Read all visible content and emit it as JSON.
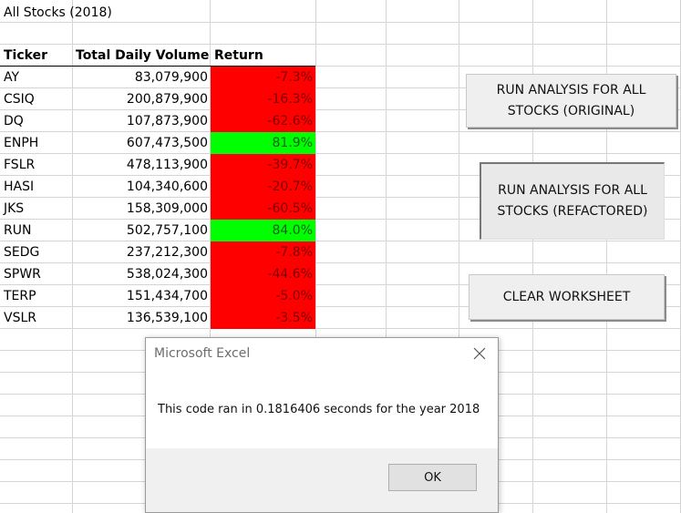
{
  "sheet": {
    "title": "All Stocks (2018)",
    "headers": {
      "ticker": "Ticker",
      "volume": "Total Daily Volume",
      "return": "Return"
    },
    "rows": [
      {
        "ticker": "AY",
        "volume": "83,079,900",
        "return": "-7.3%",
        "status": "negative"
      },
      {
        "ticker": "CSIQ",
        "volume": "200,879,900",
        "return": "-16.3%",
        "status": "negative"
      },
      {
        "ticker": "DQ",
        "volume": "107,873,900",
        "return": "-62.6%",
        "status": "negative"
      },
      {
        "ticker": "ENPH",
        "volume": "607,473,500",
        "return": "81.9%",
        "status": "positive"
      },
      {
        "ticker": "FSLR",
        "volume": "478,113,900",
        "return": "-39.7%",
        "status": "negative"
      },
      {
        "ticker": "HASI",
        "volume": "104,340,600",
        "return": "-20.7%",
        "status": "negative"
      },
      {
        "ticker": "JKS",
        "volume": "158,309,000",
        "return": "-60.5%",
        "status": "negative"
      },
      {
        "ticker": "RUN",
        "volume": "502,757,100",
        "return": "84.0%",
        "status": "positive"
      },
      {
        "ticker": "SEDG",
        "volume": "237,212,300",
        "return": "-7.8%",
        "status": "negative"
      },
      {
        "ticker": "SPWR",
        "volume": "538,024,300",
        "return": "-44.6%",
        "status": "negative"
      },
      {
        "ticker": "TERP",
        "volume": "151,434,700",
        "return": "-5.0%",
        "status": "negative"
      },
      {
        "ticker": "VSLR",
        "volume": "136,539,100",
        "return": "-3.5%",
        "status": "negative"
      }
    ],
    "colors": {
      "negative": "#ff0000",
      "positive": "#00ff00"
    }
  },
  "buttons": {
    "run_original": {
      "line1": "RUN ANALYSIS FOR ALL",
      "line2": "STOCKS (ORIGINAL)"
    },
    "run_refactored": {
      "line1": "RUN ANALYSIS FOR ALL",
      "line2": "STOCKS (REFACTORED)"
    },
    "clear": {
      "label": "CLEAR WORKSHEET"
    }
  },
  "dialog": {
    "title": "Microsoft Excel",
    "message": "This code ran in 0.1816406 seconds for the year 2018",
    "ok_label": "OK",
    "close_icon": "close-icon"
  }
}
